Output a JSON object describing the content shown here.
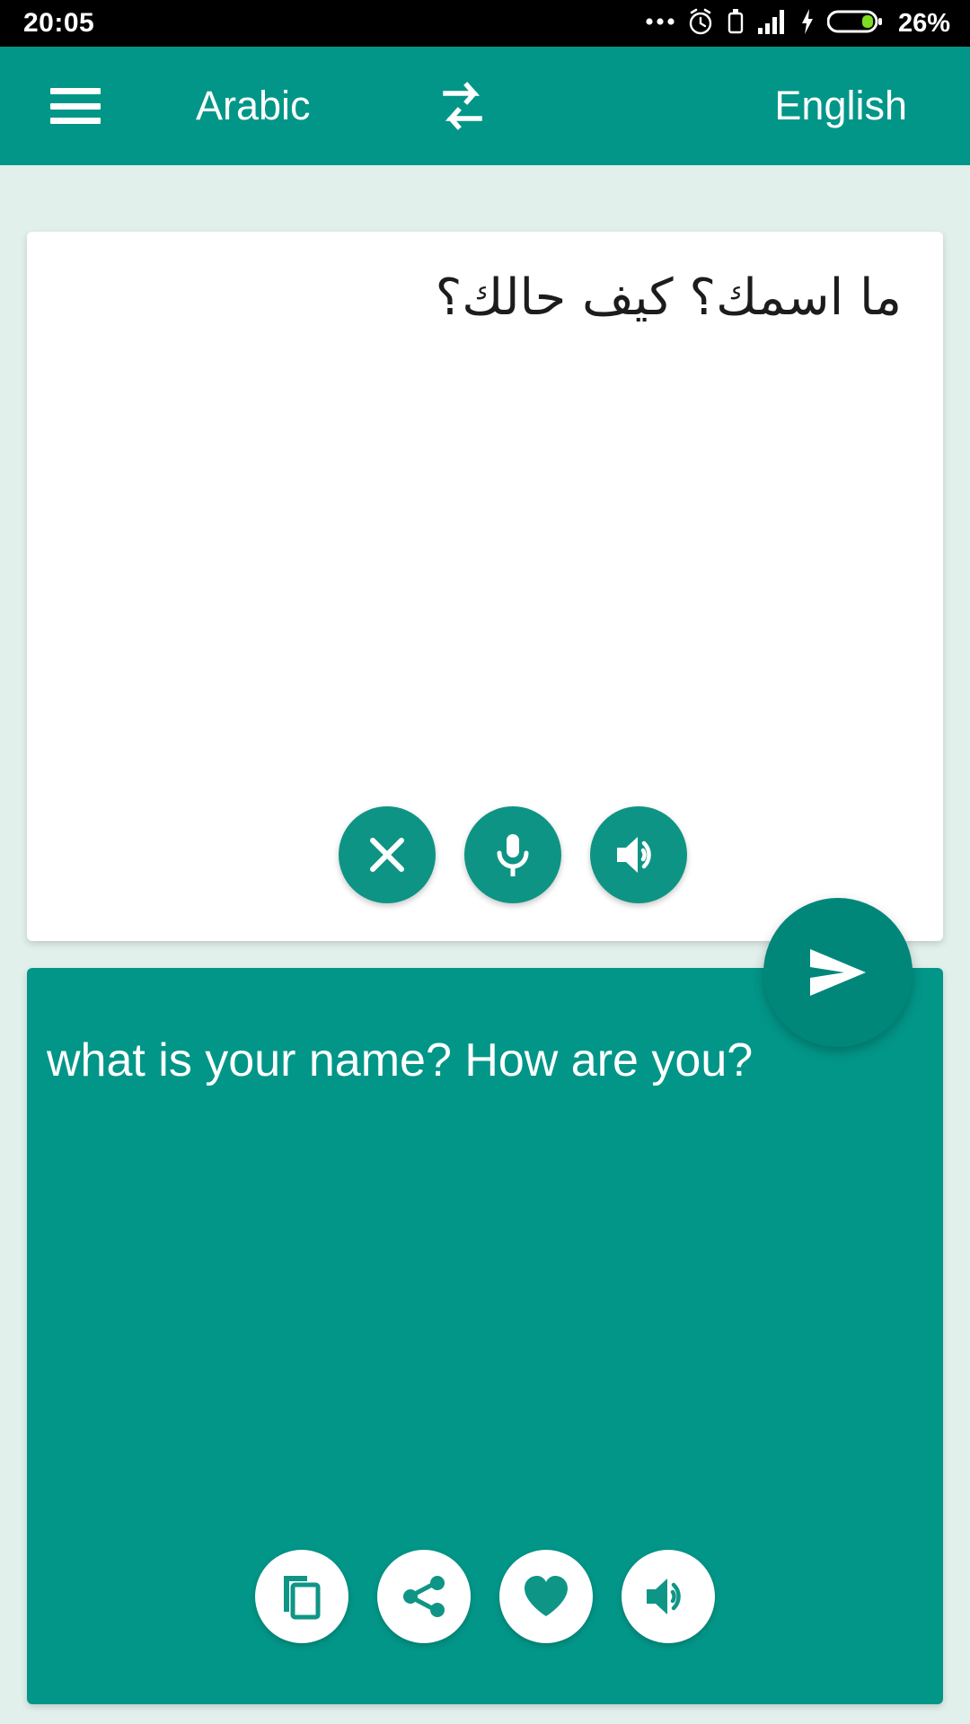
{
  "status_bar": {
    "clock": "20:05",
    "battery_percent": "26%",
    "icons": [
      "more-dots-icon",
      "alarm-clock-icon",
      "usb-debug-icon",
      "signal-bars-icon",
      "charging-bolt-icon",
      "battery-icon"
    ]
  },
  "appbar": {
    "menu_icon": "hamburger-menu-icon",
    "source_language": "Arabic",
    "swap_icon": "swap-languages-icon",
    "target_language": "English",
    "background_color": "#029688"
  },
  "source_card": {
    "text": "ما اسمك؟ كيف حالك؟",
    "background_color": "#ffffff",
    "actions": [
      {
        "name": "clear-button",
        "icon": "close-x-icon"
      },
      {
        "name": "mic-button",
        "icon": "microphone-icon"
      },
      {
        "name": "speak-source-button",
        "icon": "speaker-icon"
      }
    ]
  },
  "send_button": {
    "name": "send-button",
    "icon": "send-arrow-icon",
    "color": "#00877a"
  },
  "target_card": {
    "text": "what is your name? How are you?",
    "background_color": "#029688",
    "actions": [
      {
        "name": "copy-button",
        "icon": "copy-icon"
      },
      {
        "name": "share-button",
        "icon": "share-icon"
      },
      {
        "name": "favorite-button",
        "icon": "heart-icon"
      },
      {
        "name": "speak-target-button",
        "icon": "speaker-icon"
      }
    ]
  },
  "theme": {
    "primary": "#029688",
    "primary_dark": "#00877a",
    "page_background": "#e2f0ec",
    "accent_text": "#ffffff"
  }
}
